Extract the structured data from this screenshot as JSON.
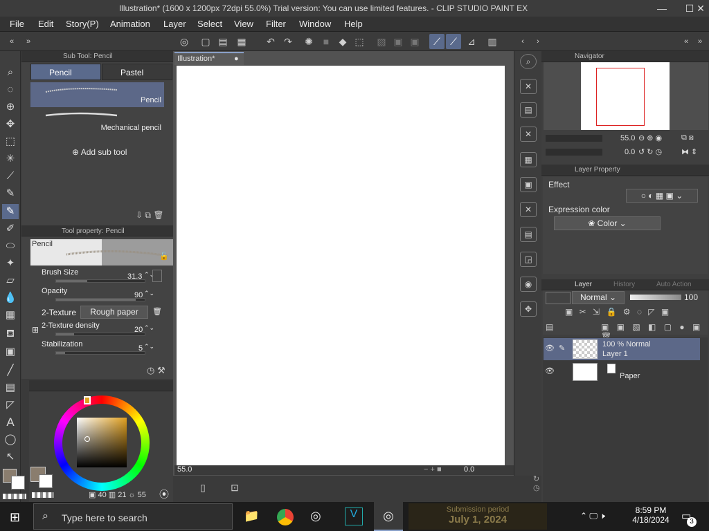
{
  "window": {
    "title": "Illustration* (1600 x 1200px 72dpi 55.0%)  Trial version: You can use limited features. - CLIP STUDIO PAINT EX",
    "min": "—",
    "max": "☐",
    "close": "✕"
  },
  "menu": [
    "File",
    "Edit",
    "Story(P)",
    "Animation",
    "Layer",
    "Select",
    "View",
    "Filter",
    "Window",
    "Help"
  ],
  "subtool": {
    "header": "Sub Tool: Pencil",
    "tabs": [
      "Pencil",
      "Pastel"
    ],
    "brushes": [
      "Pencil",
      "Mechanical pencil"
    ],
    "add": "Add sub tool"
  },
  "toolprop": {
    "header": "Tool property: Pencil",
    "preview_label": "Pencil",
    "brush_size": {
      "label": "Brush Size",
      "value": "31.3",
      "level": 0.35
    },
    "opacity": {
      "label": "Opacity",
      "value": "90",
      "level": 0.9
    },
    "texture": {
      "label": "2-Texture",
      "value": "Rough paper"
    },
    "texture_density": {
      "label": "2-Texture density",
      "value": "20",
      "level": 0.2
    },
    "stabilization": {
      "label": "Stabilization",
      "value": "5",
      "level": 0.1
    }
  },
  "color": {
    "h": "40",
    "s": "21",
    "v": "55"
  },
  "canvas": {
    "tab": "Illustration*",
    "zoom": "55.0",
    "rotate": "0.0"
  },
  "navigator": {
    "header": "Navigator",
    "zoom": "55.0",
    "rotate": "0.0"
  },
  "layerprop": {
    "header": "Layer Property",
    "effect": "Effect",
    "expression_label": "Expression color",
    "expression_value": "Color"
  },
  "layer": {
    "tabs": [
      "Layer",
      "History",
      "Auto Action"
    ],
    "blend": "Normal",
    "opacity": "100",
    "rows": [
      {
        "line1": "100 % Normal",
        "line2": "Layer 1"
      },
      {
        "line1": "",
        "line2": "Paper"
      }
    ]
  },
  "taskbar": {
    "search": "Type here to search",
    "banner_line1": "Submission period",
    "banner_line2": "July 1, 2024",
    "time": "8:59 PM",
    "date": "4/18/2024",
    "notify": "3"
  },
  "colors": {
    "accent": "#5a6a8c",
    "selected_row": "#5c6888"
  }
}
